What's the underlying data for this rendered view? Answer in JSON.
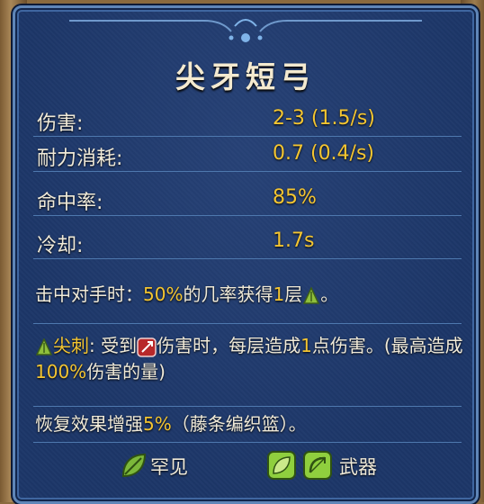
{
  "item": {
    "name": "尖牙短弓"
  },
  "stats": [
    {
      "label": "伤害:",
      "value": "2-3 (1.5/s)"
    },
    {
      "label": "耐力消耗:",
      "value": "0.7 (0.4/s)"
    },
    {
      "label": "命中率:",
      "value": "85%"
    },
    {
      "label": "冷却:",
      "value": "1.7s"
    }
  ],
  "effect_on_hit": {
    "prefix": "击中对手时：",
    "chance": "50%",
    "middle": "的几率获得",
    "count": "1",
    "suffix": "层",
    "end": "。",
    "icon": "spike-icon"
  },
  "spike_desc": {
    "name": "尖刺",
    "p1": ": 受到",
    "p2": "伤害时，每层造成",
    "num": "1",
    "p3": "点伤害。(最高造成",
    "pct": "100%",
    "p4": "伤害的量)",
    "icons": [
      "spike-icon",
      "physical-damage-icon"
    ]
  },
  "bonus": {
    "prefix": "恢复效果增强",
    "pct": "5%",
    "suffix": "（藤条编织篮）。"
  },
  "footer": {
    "rarity": "罕见",
    "type": "武器",
    "rarity_icon": "leaf-icon",
    "type_icons": [
      "leaf-icon",
      "bow-icon"
    ]
  },
  "colors": {
    "panel": "#1d3769",
    "border": "#5f86b8",
    "highlight": "#f4c531",
    "text": "#f0ead8"
  }
}
